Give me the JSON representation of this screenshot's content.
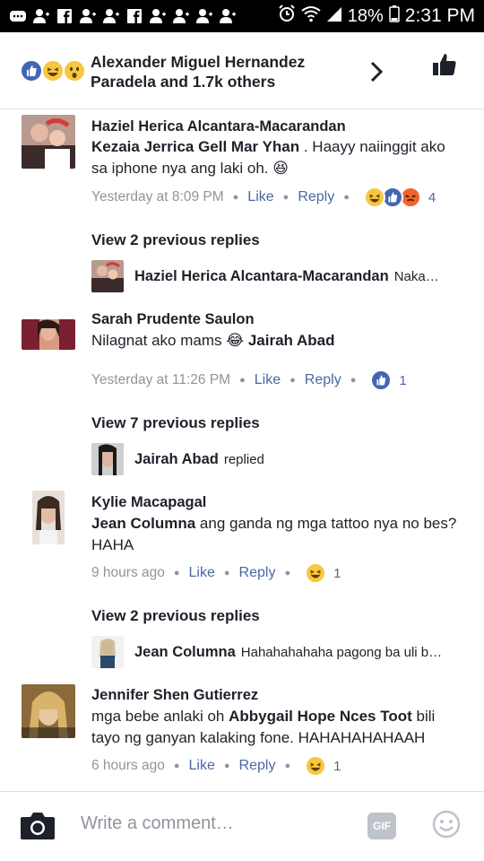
{
  "status_bar": {
    "battery": "18%",
    "time": "2:31 PM"
  },
  "header": {
    "names_line1": "Alexander Miguel Hernandez",
    "names_line2": "Paradela and 1.7k others"
  },
  "comments": [
    {
      "name": "Haziel Herica Alcantara-Macarandan",
      "mention": "Kezaia Jerrica Gell Mar Yhan",
      "text": " . Haayy naiinggit ako sa iphone nya ang laki oh. 😆",
      "time": "Yesterday at 8:09 PM",
      "like": "Like",
      "reply": "Reply",
      "reaction_count": "4",
      "view_prev": "View 2 previous replies",
      "reply_name": "Haziel Herica Alcantara-Macarandan",
      "reply_text": "Naka…"
    },
    {
      "name": "Sarah Prudente Saulon",
      "text": "Nilagnat ako mams 😂 ",
      "mention": "Jairah Abad",
      "time": "Yesterday at 11:26 PM",
      "like": "Like",
      "reply": "Reply",
      "reaction_count": "1",
      "view_prev": "View 7 previous replies",
      "reply_name": "Jairah Abad",
      "reply_text": "replied"
    },
    {
      "name": "Kylie Macapagal",
      "mention": "Jean Columna",
      "text": " ang ganda ng mga tattoo nya no bes? HAHA",
      "time": "9 hours ago",
      "like": "Like",
      "reply": "Reply",
      "reaction_count": "1",
      "view_prev": "View 2 previous replies",
      "reply_name": "Jean Columna",
      "reply_text": "Hahahahahaha pagong ba uli b…"
    },
    {
      "name": "Jennifer Shen Gutierrez",
      "text_before": "mga bebe anlaki oh ",
      "mention": "Abbygail Hope Nces Toot",
      "text_after": "  bili tayo ng ganyan kalaking fone.  HAHAHAHAHAAH",
      "time": "6 hours ago",
      "like": "Like",
      "reply": "Reply",
      "reaction_count": "1"
    }
  ],
  "composer": {
    "placeholder": "Write a comment…",
    "gif_label": "GIF"
  },
  "colors": {
    "like_blue": "#4267b2",
    "haha_yellow": "#f7c741",
    "angry_orange": "#f0642b",
    "link": "#4b67a1",
    "meta_grey": "#90949c"
  }
}
